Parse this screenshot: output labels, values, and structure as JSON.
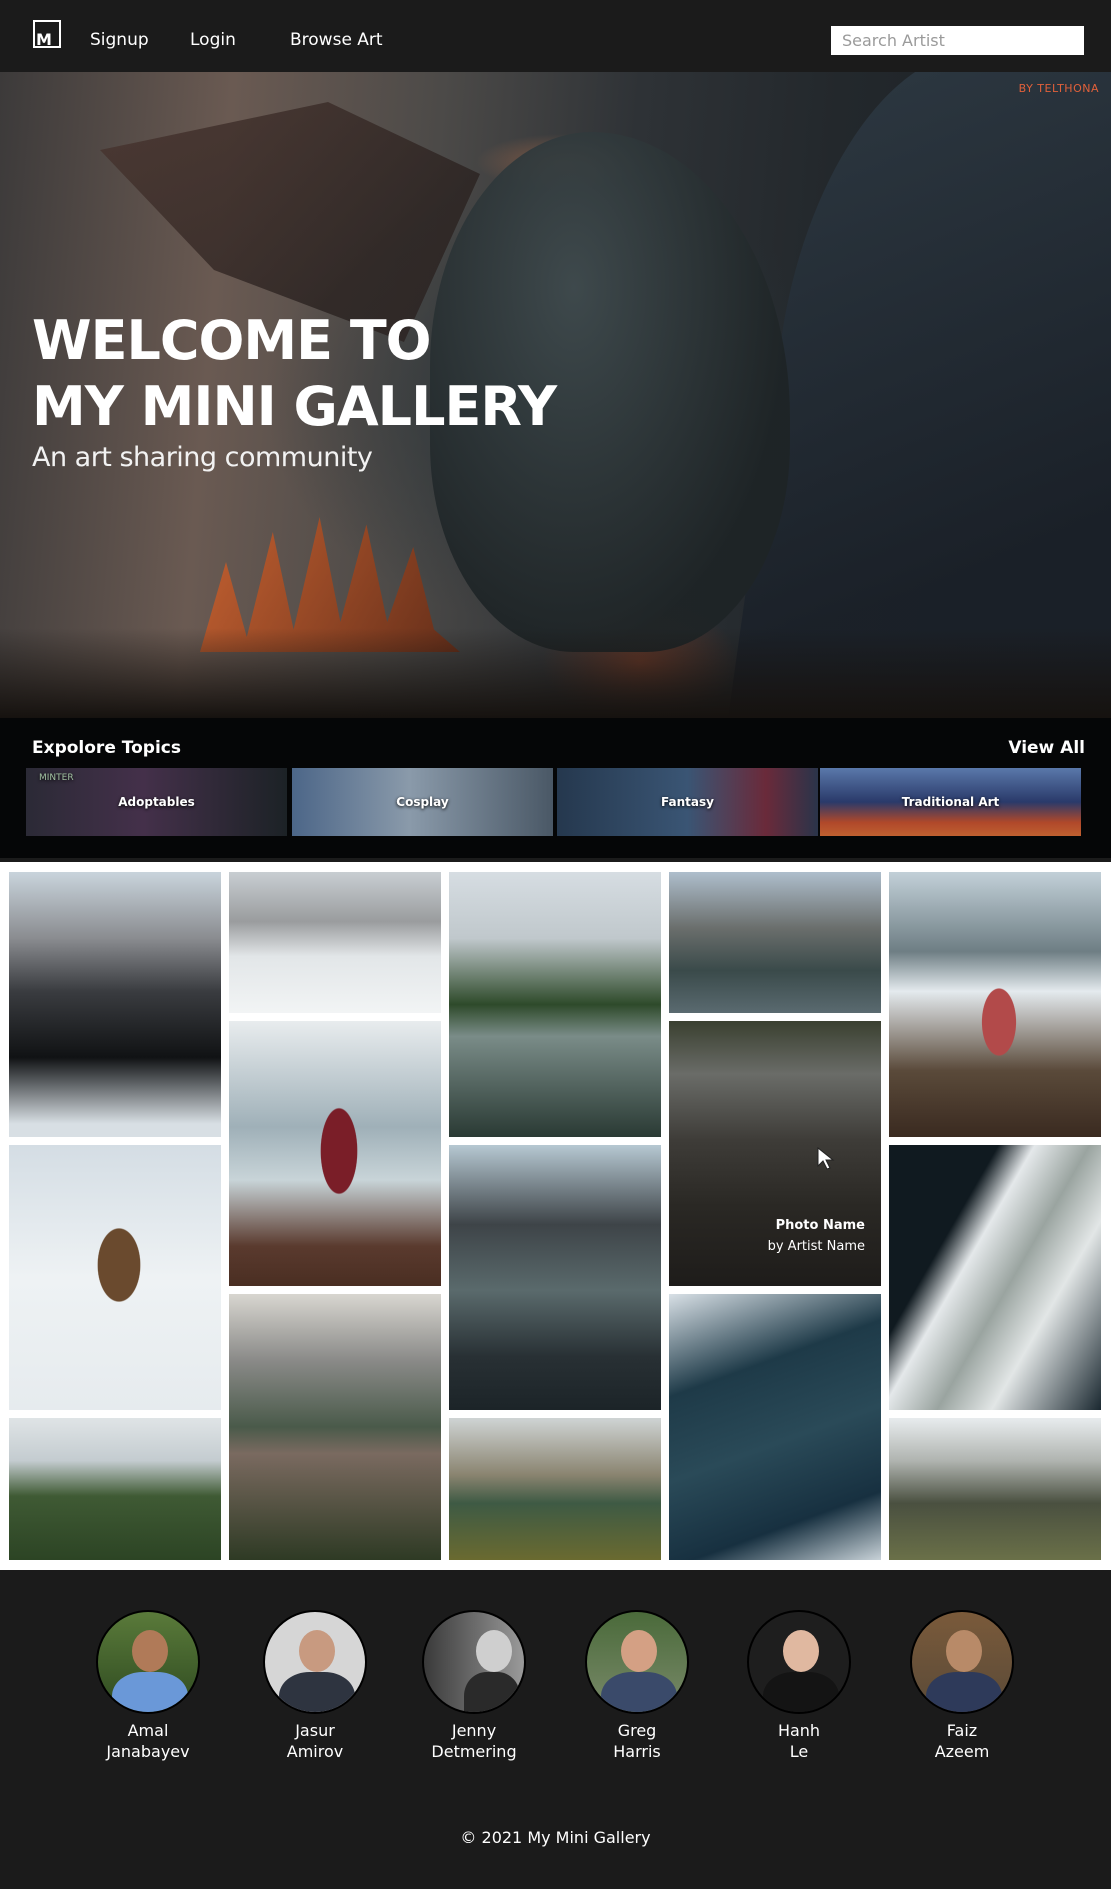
{
  "nav": {
    "logo": "M",
    "links": [
      "Signup",
      "Login",
      "Browse Art"
    ],
    "search_placeholder": "Search Artist"
  },
  "hero": {
    "watermark": "BY TELTHONA",
    "title_line1": "WELCOME TO",
    "title_line2": "MY MINI GALLERY",
    "subtitle": "An art sharing community"
  },
  "topics": {
    "heading": "Expolore Topics",
    "view_all": "View All",
    "cards": [
      "Adoptables",
      "Cosplay",
      "Fantasy",
      "Traditional Art"
    ],
    "card1_tag": "MINTER"
  },
  "gallery": {
    "hover_photo_name": "Photo Name",
    "hover_artist": "by Artist Name"
  },
  "team": {
    "members": [
      {
        "first": "Amal",
        "last": "Janabayev"
      },
      {
        "first": "Jasur",
        "last": "Amirov"
      },
      {
        "first": "Jenny",
        "last": "Detmering"
      },
      {
        "first": "Greg",
        "last": "Harris"
      },
      {
        "first": "Hanh",
        "last": "Le"
      },
      {
        "first": "Faiz",
        "last": "Azeem"
      }
    ]
  },
  "footer": {
    "copyright": "© 2021 My Mini Gallery"
  },
  "colors": {
    "nav_bg": "#1b1b1b",
    "topics_bg": "#050607",
    "gallery_bg": "#ffffff",
    "accent": "#e0603a"
  }
}
